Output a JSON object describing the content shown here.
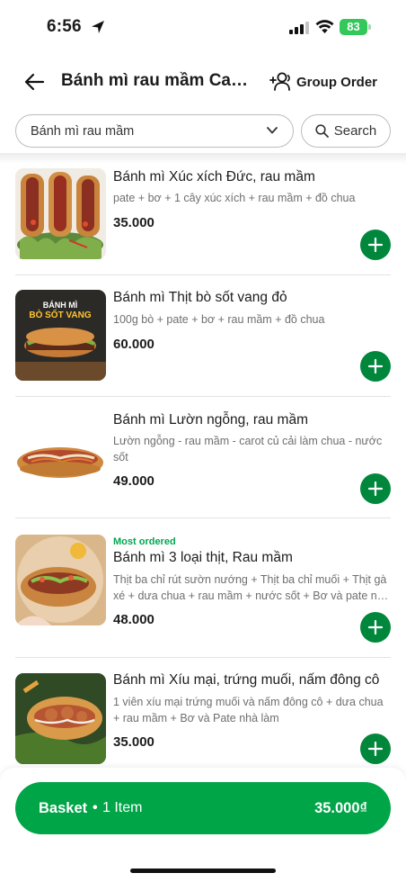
{
  "status_bar": {
    "time": "6:56",
    "battery": "83"
  },
  "header": {
    "title": "Bánh mì rau mầm Car...",
    "group_order_label": "Group Order"
  },
  "filter": {
    "category_value": "Bánh mì rau mầm",
    "search_label": "Search"
  },
  "menu_items": [
    {
      "badge": "",
      "name": "Bánh mì Xúc xích Đức, rau mầm",
      "description": "pate + bơ + 1 cây xúc xích + rau mầm + đồ chua",
      "price": "35.000"
    },
    {
      "badge": "",
      "name": "Bánh mì Thịt bò sốt vang đỏ",
      "description": "100g bò + pate + bơ + rau mầm + đồ chua",
      "price": "60.000",
      "image_text_1": "BÁNH MÌ",
      "image_text_2": "BÒ SỐT VANG"
    },
    {
      "badge": "",
      "name": "Bánh mì Lườn ngỗng, rau mầm",
      "description": "Lườn ngỗng - rau mầm - carot củ cải làm chua - nước sốt",
      "price": "49.000"
    },
    {
      "badge": "Most ordered",
      "name": "Bánh mì 3 loại thịt, Rau mầm",
      "description_line1": "Thịt ba chỉ rút sườn nướng + Thịt ba chỉ muối + Thịt gà",
      "description_line2": "xé + dưa chua + rau mầm + nước sốt + Bơ và pate nhà...",
      "price": "48.000"
    },
    {
      "badge": "",
      "name": "Bánh mì Xíu mại, trứng muối, nấm đông cô",
      "description": "1 viên xíu mại trứng muối và nấm đông cô + dưa chua + rau mầm + Bơ và Pate nhà làm",
      "price": "35.000"
    }
  ],
  "basket": {
    "label": "Basket",
    "separator": "•",
    "count": "1 Item",
    "total": "35.000₫"
  },
  "colors": {
    "brand_green": "#00a548",
    "add_button_green": "#00873c",
    "badge_green": "#00a651",
    "battery_green": "#34c759"
  }
}
